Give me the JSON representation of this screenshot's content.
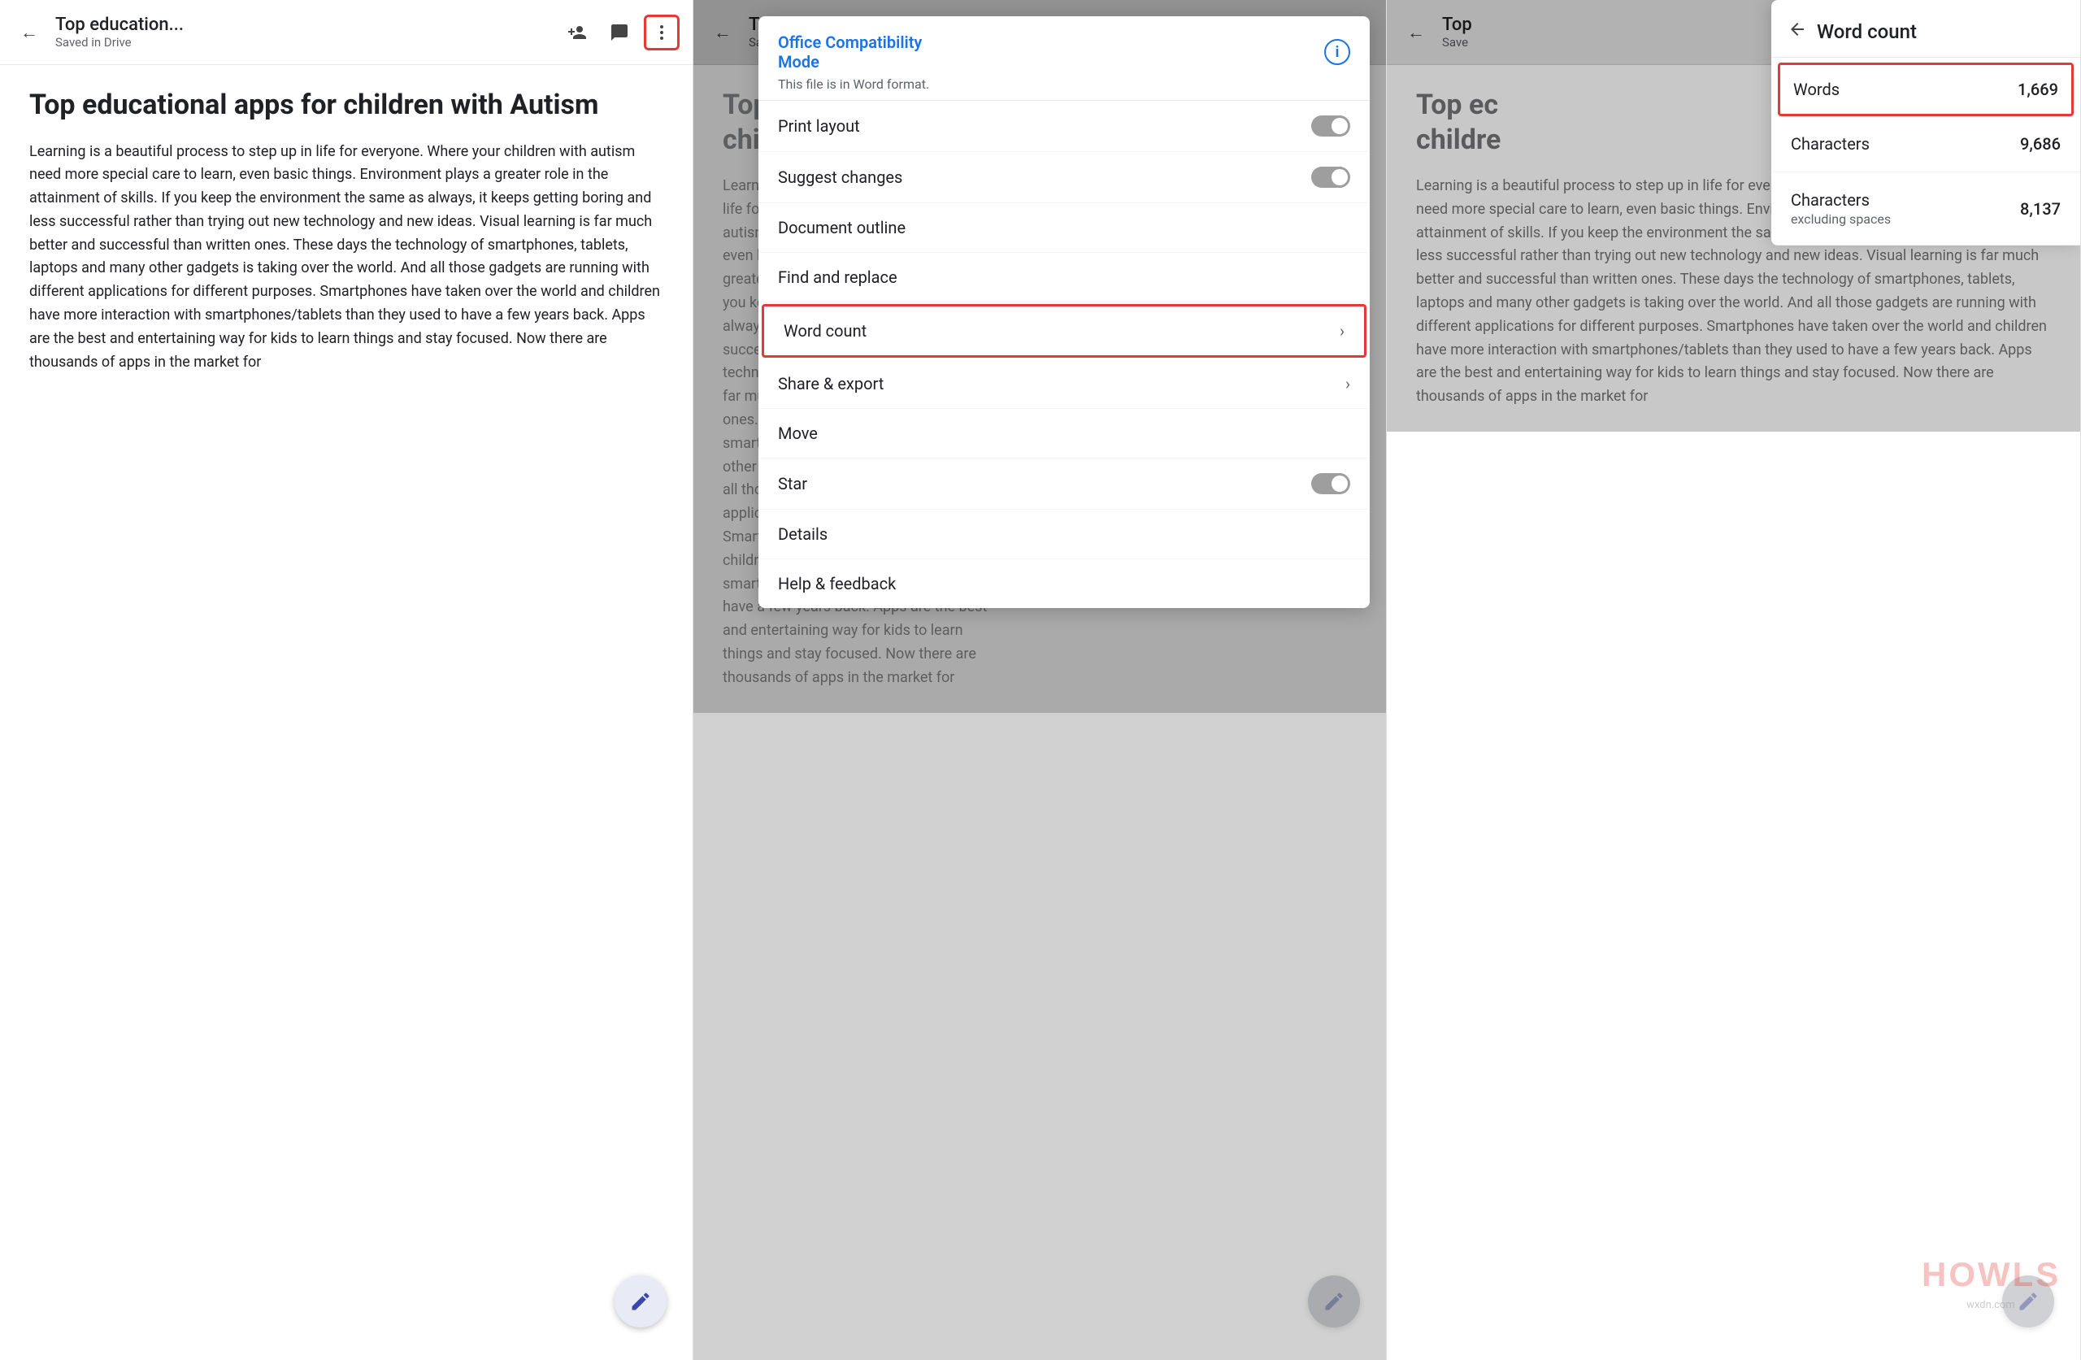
{
  "panels": [
    {
      "id": "panel1",
      "topbar": {
        "back_icon": "←",
        "title": "Top education...",
        "subtitle": "Saved in Drive",
        "icons": [
          "person-add",
          "comment",
          "more-vert"
        ],
        "more_icon": "⋮"
      },
      "doc": {
        "title": "Top educational apps for children with Autism",
        "text": "Learning is a beautiful process to step up in life for everyone. Where your children with autism need more special care to learn, even basic things. Environment plays a greater role in the attainment of skills. If you keep the environment the same as always, it keeps getting boring and less successful rather than trying out new technology and new ideas. Visual learning is far much better and successful than written ones. These days the technology of smartphones, tablets, laptops and many other gadgets is taking over the world. And all those gadgets are running with different applications for different purposes. Smartphones have taken over the world and children have more interaction with smartphones/tablets than they used to have a few years back. Apps are the best and entertaining way for kids to learn things and stay focused. Now there are thousands of apps in the market for"
      },
      "fab": "✏️"
    },
    {
      "id": "panel2",
      "topbar": {
        "back_icon": "←",
        "title": "Top",
        "subtitle": "Save"
      },
      "doc": {
        "title": "Top ec",
        "title2": "childre",
        "text": "Learning is...\nlife for eve...\nautism nee...\neven basic...\ngreater rol...\nyou keep t...\nalways, it k...\nsuccessful...\ntechnolog...\nfar much b...\nones. Thes...\nsmartphon...\nother gad...\nall those g...\napplication...\nSmartpho...\nchildren h...\nsmartphon...\nhave a few years back. Apps are the best\nand entertaining way for kids to learn\nthings and stay focused. Now there are\nthousands of apps in the market for"
      },
      "dropdown": {
        "header_title": "Office Compatibility\nMode",
        "header_info": "This file is in Word format.",
        "items": [
          {
            "label": "Print layout",
            "type": "toggle",
            "value": false
          },
          {
            "label": "Suggest changes",
            "type": "toggle",
            "value": false
          },
          {
            "label": "Document outline",
            "type": "none"
          },
          {
            "label": "Find and replace",
            "type": "none"
          },
          {
            "label": "Word count",
            "type": "chevron",
            "highlighted": true
          },
          {
            "label": "Share & export",
            "type": "chevron"
          },
          {
            "label": "Move",
            "type": "none"
          },
          {
            "label": "Star",
            "type": "toggle",
            "value": false
          },
          {
            "label": "Details",
            "type": "none"
          },
          {
            "label": "Help & feedback",
            "type": "none"
          }
        ]
      },
      "fab": "✏️"
    },
    {
      "id": "panel3",
      "topbar": {
        "back_icon": "←",
        "title": "Top",
        "subtitle": "Save"
      },
      "doc": {
        "title": "Top ec",
        "title2": "childre",
        "text": "Learning is a beautiful process to step up in life for everyone. Where your children with autism need more special care to learn, even basic things. Environment plays a greater role in the attainment of skills. If you keep the environment the same as always, it keeps getting boring and less successful rather than trying out new technology and new ideas. Visual learning is far much better and successful than written ones. These days the technology of smartphones, tablets, laptops and many other gadgets is taking over the world. And all those gadgets are running with different applications for different purposes. Smartphones have taken over the world and children have more interaction with smartphones/tablets than they used to have a few years back. Apps are the best and entertaining way for kids to learn things and stay focused. Now there are thousands of apps in the market for"
      },
      "word_count": {
        "back_icon": "←",
        "title": "Word count",
        "rows": [
          {
            "label": "Words",
            "value": "1,669",
            "highlighted": true
          },
          {
            "label": "Characters",
            "value": "9,686"
          },
          {
            "label": "Characters",
            "sublabel": "excluding spaces",
            "value": "8,137"
          }
        ]
      },
      "fab": "✏️",
      "watermark": "HOWL"
    }
  ]
}
